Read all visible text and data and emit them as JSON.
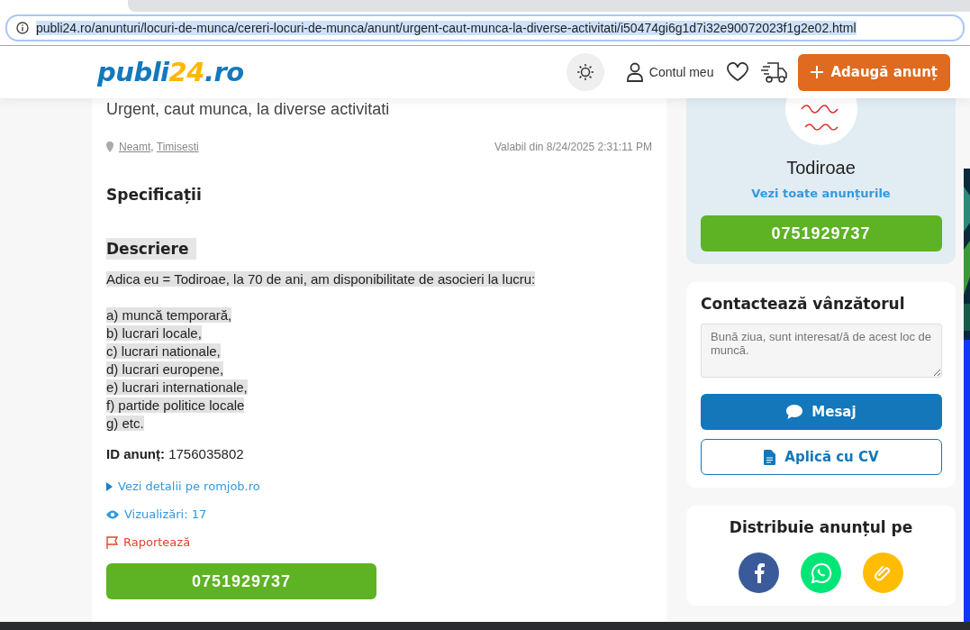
{
  "browser": {
    "url": "publi24.ro/anunturi/locuri-de-munca/cereri-locuri-de-munca/anunt/urgent-caut-munca-la-diverse-activitati/i50474gi6g1d7i32e90072023f1g2e02.html"
  },
  "header": {
    "logo": {
      "main": "publi",
      "accent": "24",
      "suffix": ".ro"
    },
    "account": "Contul meu",
    "add_button": "Adaugă anunț"
  },
  "ad": {
    "title": "Urgent, caut munca, la diverse activitati",
    "location": [
      "Neamt",
      "Timisesti"
    ],
    "location_separator": ",",
    "valid": "Valabil din 8/24/2025 2:31:11 PM",
    "specs_heading": "Specificații",
    "description_heading": "Descriere",
    "description_intro": "Adica eu = Todiroae, la 70 de ani, am disponibilitate de asocieri la lucru:",
    "description_lines": [
      "a) muncă temporară,",
      "b) lucrari locale,",
      "c) lucrari nationale,",
      "d) lucrari europene,",
      "e) lucrari internationale,",
      "f) partide politice locale",
      "g) etc."
    ],
    "id_label": "ID anunț:",
    "id_value": "1756035802",
    "details_link": "Vezi detalii pe romjob.ro",
    "views": "Vizualizări: 17",
    "report": "Raportează",
    "phone": "0751929737"
  },
  "seller": {
    "name": "Todiroae",
    "all_ads": "Vezi toate anunțurile",
    "phone": "0751929737"
  },
  "contact": {
    "heading": "Contactează vânzătorul",
    "placeholder": "Bună ziua, sunt interesat/ă de acest loc de muncă.",
    "message_button": "Mesaj",
    "cv_button": "Aplică cu CV"
  },
  "share": {
    "heading": "Distribuie anunțul pe",
    "targets": [
      {
        "kind": "facebook",
        "color": "#3b5a9a"
      },
      {
        "kind": "whatsapp",
        "color": "#00e676"
      },
      {
        "kind": "link",
        "color": "#ffbc00"
      }
    ]
  }
}
